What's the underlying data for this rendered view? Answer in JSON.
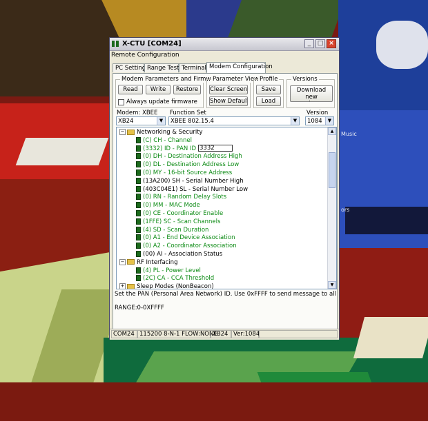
{
  "window": {
    "title": "X-CTU  [COM24]",
    "menu": "Remote Configuration"
  },
  "tabs": [
    {
      "label": "PC Settings"
    },
    {
      "label": "Range Test"
    },
    {
      "label": "Terminal"
    },
    {
      "label": "Modem Configuration",
      "active": true
    }
  ],
  "groups": {
    "modem_params": {
      "label": "Modem Parameters and Firmware",
      "read": "Read",
      "write": "Write",
      "restore": "Restore",
      "always_update": "Always update firmware"
    },
    "param_view": {
      "label": "Parameter View",
      "clear_screen": "Clear Screen",
      "show_defaults": "Show Defaults"
    },
    "profile": {
      "label": "Profile",
      "save": "Save",
      "load": "Load"
    },
    "versions": {
      "label": "Versions",
      "download": "Download new versions..."
    }
  },
  "selectors": {
    "modem_label": "Modem: XBEE",
    "modem_value": "XB24",
    "function_label": "Function Set",
    "function_value": "XBEE 802.15.4",
    "version_label": "Version",
    "version_value": "1084"
  },
  "tree": [
    {
      "kind": "folder",
      "text": "Networking & Security"
    },
    {
      "kind": "param",
      "color": "green",
      "text": "(C) CH - Channel"
    },
    {
      "kind": "edit",
      "color": "green",
      "text": "(3332) ID - PAN ID",
      "edit": "3332"
    },
    {
      "kind": "param",
      "color": "green",
      "text": "(0) DH - Destination Address High"
    },
    {
      "kind": "param",
      "color": "green",
      "text": "(0) DL - Destination Address Low"
    },
    {
      "kind": "param",
      "color": "green",
      "text": "(0) MY - 16-bit Source Address"
    },
    {
      "kind": "param",
      "color": "black",
      "text": "(13A200) SH - Serial Number High"
    },
    {
      "kind": "param",
      "color": "black",
      "text": "(403C04E1) SL - Serial Number Low"
    },
    {
      "kind": "param",
      "color": "green",
      "text": "(0) RN - Random Delay Slots"
    },
    {
      "kind": "param",
      "color": "green",
      "text": "(0) MM - MAC Mode"
    },
    {
      "kind": "param",
      "color": "green",
      "text": "(0) CE - Coordinator Enable"
    },
    {
      "kind": "param",
      "color": "green",
      "text": "(1FFE) SC - Scan Channels"
    },
    {
      "kind": "param",
      "color": "green",
      "text": "(4) SD - Scan Duration"
    },
    {
      "kind": "param",
      "color": "green",
      "text": "(0) A1 - End Device Association"
    },
    {
      "kind": "param",
      "color": "green",
      "text": "(0) A2 - Coordinator Association"
    },
    {
      "kind": "param",
      "color": "black",
      "text": "(00) AI - Association Status"
    },
    {
      "kind": "folder",
      "text": "RF Interfacing"
    },
    {
      "kind": "param",
      "color": "green",
      "text": "(4) PL - Power Level"
    },
    {
      "kind": "param",
      "color": "green",
      "text": "(2C) CA - CCA Threshold"
    },
    {
      "kind": "folder",
      "text": "Sleep Modes (NonBeacon)"
    }
  ],
  "description": "Set the PAN (Personal Area Network) ID.  Use 0xFFFF to send message to all PAN's.",
  "range": "RANGE:0-0XFFFF",
  "status": {
    "port": "COM24",
    "settings": "115200 8-N-1  FLOW:NONE",
    "modem": "XB24",
    "version": "Ver:1084"
  },
  "background_text": [
    "Music",
    "ors"
  ],
  "colors": {
    "param_green": "#0a8a12",
    "close_button": "#d8442e"
  }
}
